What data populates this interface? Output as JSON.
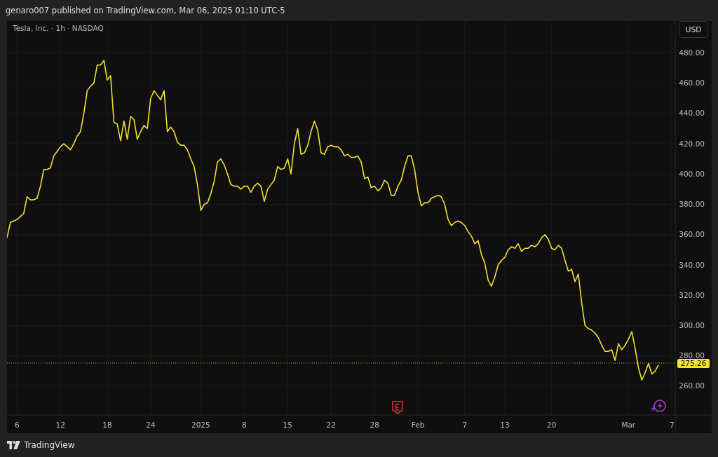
{
  "header": {
    "text": "genaro007 published on TradingView.com, Mar 06, 2025 01:10 UTC-5"
  },
  "chart": {
    "symbol_title": "Tesla, Inc. · 1h · NASDAQ",
    "currency_button": "USD",
    "chart_data": {
      "type": "line",
      "grid": true,
      "ylim": [
        241,
        501
      ],
      "ref_lines": [
        {
          "axis": "y",
          "value": 275.26,
          "label": "275.26",
          "color": "#c9b82a"
        }
      ],
      "yticks": [
        {
          "value": 260,
          "label": "260.00"
        },
        {
          "value": 280,
          "label": "280.00"
        },
        {
          "value": 300,
          "label": "300.00"
        },
        {
          "value": 320,
          "label": "320.00"
        },
        {
          "value": 340,
          "label": "340.00"
        },
        {
          "value": 360,
          "label": "360.00"
        },
        {
          "value": 380,
          "label": "380.00"
        },
        {
          "value": 400,
          "label": "400.00"
        },
        {
          "value": 420,
          "label": "420.00"
        },
        {
          "value": 440,
          "label": "440.00"
        },
        {
          "value": 460,
          "label": "460.00"
        },
        {
          "value": 480,
          "label": "480.00"
        }
      ],
      "categories": [
        null,
        null,
        null,
        "6",
        null,
        null,
        null,
        null,
        null,
        null,
        null,
        null,
        null,
        null,
        null,
        null,
        "12",
        null,
        null,
        null,
        null,
        null,
        null,
        null,
        null,
        null,
        null,
        null,
        null,
        null,
        "18",
        null,
        null,
        null,
        null,
        null,
        null,
        null,
        null,
        null,
        null,
        null,
        null,
        "24",
        null,
        null,
        null,
        null,
        null,
        null,
        null,
        null,
        null,
        null,
        null,
        null,
        null,
        null,
        "2025",
        null,
        null,
        null,
        null,
        null,
        null,
        null,
        null,
        null,
        null,
        null,
        null,
        "8",
        null,
        null,
        null,
        null,
        null,
        null,
        null,
        null,
        null,
        null,
        null,
        null,
        "15",
        null,
        null,
        null,
        null,
        null,
        null,
        null,
        null,
        null,
        null,
        null,
        null,
        "22",
        null,
        null,
        null,
        null,
        null,
        null,
        null,
        null,
        null,
        null,
        null,
        null,
        "28",
        null,
        null,
        null,
        null,
        null,
        null,
        null,
        null,
        null,
        null,
        null,
        null,
        "Feb",
        null,
        null,
        null,
        null,
        null,
        null,
        null,
        null,
        null,
        null,
        null,
        null,
        null,
        "7",
        null,
        null,
        null,
        null,
        null,
        null,
        null,
        null,
        null,
        null,
        null,
        "13",
        null,
        null,
        null,
        null,
        null,
        null,
        null,
        null,
        null,
        null,
        null,
        null,
        null,
        "20",
        null,
        null,
        null,
        null,
        null,
        null,
        null,
        null,
        null,
        null,
        null,
        null,
        null,
        null,
        null,
        null,
        null,
        null,
        null,
        null,
        null,
        null,
        "Mar",
        null,
        null,
        null,
        null,
        null,
        null,
        null,
        null,
        null,
        null,
        null,
        null,
        "7"
      ],
      "values": [
        358,
        368,
        369,
        370,
        372,
        374,
        385,
        383,
        383,
        384,
        392,
        403,
        403,
        404,
        412,
        415,
        418,
        420,
        418,
        416,
        420,
        425,
        428,
        440,
        455,
        458,
        460,
        472,
        472,
        475,
        462,
        465,
        434,
        433,
        422,
        435,
        423,
        438,
        436,
        423,
        428,
        432,
        430,
        450,
        455,
        452,
        449,
        455,
        428,
        431,
        428,
        421,
        419,
        419,
        416,
        410,
        405,
        393,
        376,
        380,
        381,
        387,
        395,
        408,
        410,
        406,
        400,
        393,
        392,
        392,
        390,
        392,
        392,
        388,
        392,
        394,
        392,
        382,
        390,
        393,
        396,
        405,
        403,
        404,
        410,
        400,
        420,
        430,
        413,
        414,
        419,
        428,
        435,
        429,
        414,
        413,
        418,
        419,
        418,
        418,
        416,
        412,
        413,
        411,
        411,
        412,
        408,
        397,
        398,
        391,
        392,
        389,
        391,
        396,
        394,
        386,
        386,
        392,
        396,
        405,
        412,
        412,
        403,
        388,
        379,
        381,
        381,
        384,
        385,
        386,
        385,
        380,
        370,
        366,
        368,
        369,
        368,
        366,
        362,
        359,
        354,
        356,
        347,
        341,
        330,
        326,
        332,
        340,
        343,
        345,
        350,
        352,
        351,
        354,
        349,
        351,
        351,
        353,
        352,
        354,
        358,
        360,
        357,
        351,
        350,
        353,
        351,
        343,
        336,
        337,
        329,
        334,
        315,
        300,
        298,
        297,
        295,
        292,
        287,
        283,
        283,
        284,
        277,
        288,
        284,
        287,
        291,
        296,
        285,
        272,
        264,
        269,
        275,
        268,
        270,
        274,
        null,
        null,
        null,
        null
      ]
    }
  },
  "footer": {
    "brand": "TradingView"
  }
}
